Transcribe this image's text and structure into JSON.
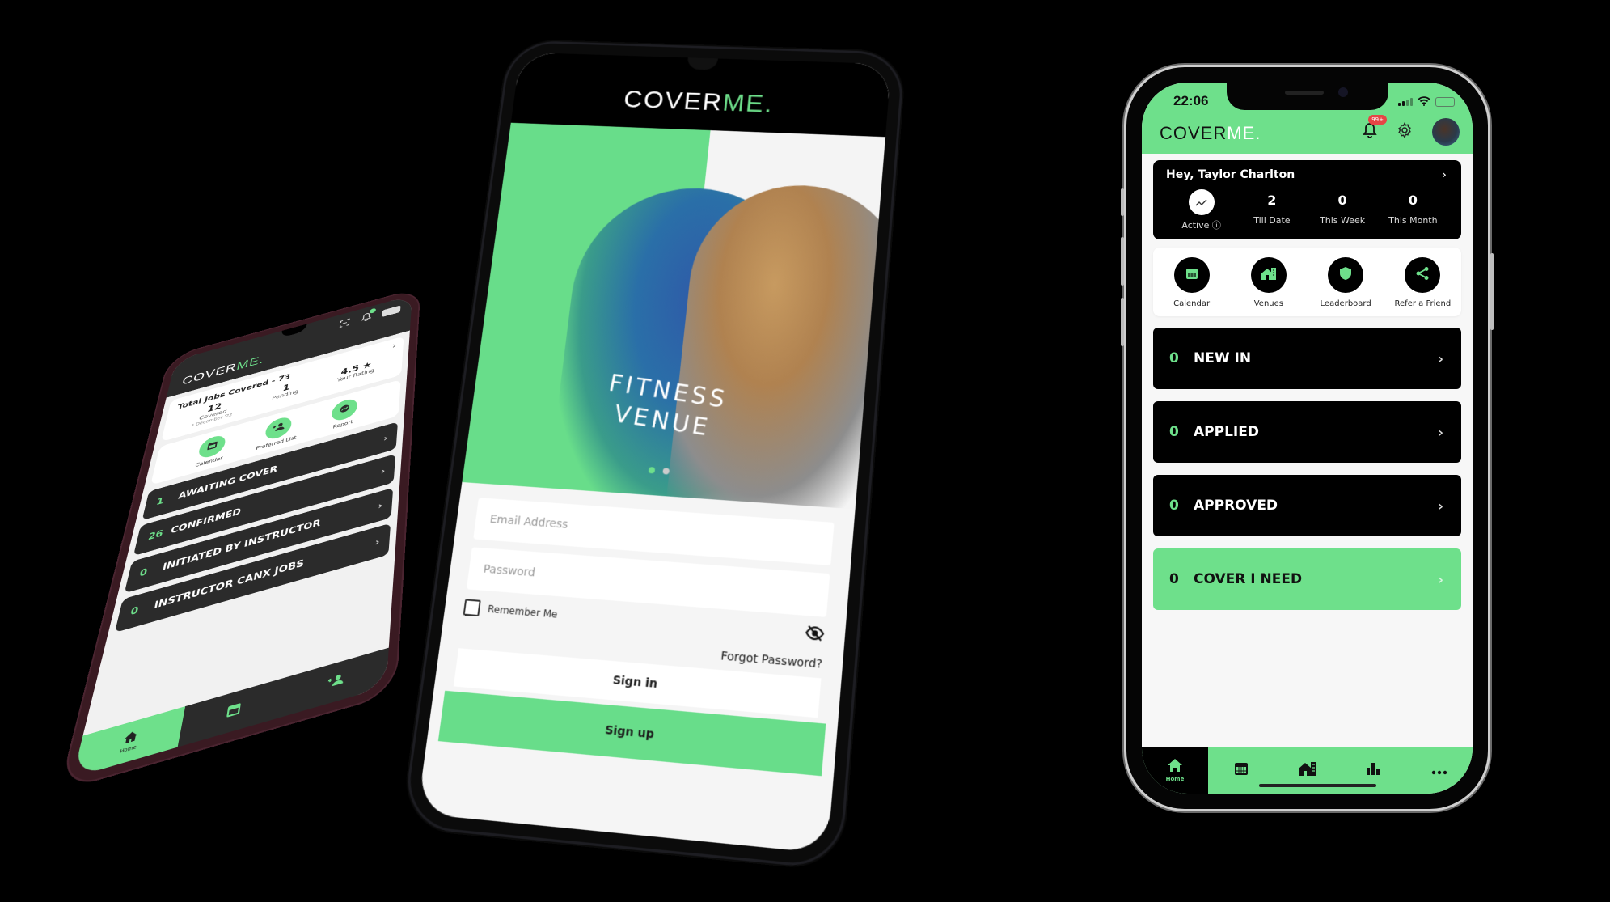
{
  "brand": {
    "name_part1": "COVER",
    "name_part2": "ME",
    "name_dot": ".",
    "accent_color": "#6ee08b",
    "dark_color": "#000000"
  },
  "left_phone": {
    "header": {
      "notification_badge": "",
      "icons": [
        "qr-scan-icon",
        "bell-icon",
        "battery-icon"
      ]
    },
    "summary": {
      "title": "Total Jobs Covered - 73",
      "stats": [
        {
          "value": "12",
          "label": "Covered",
          "sub": "* December '22"
        },
        {
          "value": "1",
          "label": "Pending",
          "sub": ""
        },
        {
          "value": "4.5 ★",
          "label": "Your Rating",
          "sub": ""
        }
      ]
    },
    "actions": [
      {
        "label": "Calendar",
        "icon": "calendar-icon"
      },
      {
        "label": "Preferred List",
        "icon": "add-user-icon"
      },
      {
        "label": "Report",
        "icon": "report-icon"
      }
    ],
    "rows": [
      {
        "count": "1",
        "label": "AWAITING COVER"
      },
      {
        "count": "26",
        "label": "CONFIRMED"
      },
      {
        "count": "0",
        "label": "INITIATED BY INSTRUCTOR"
      },
      {
        "count": "0",
        "label": "INSTRUCTOR CANX JOBS"
      }
    ],
    "tabs": [
      {
        "label": "Home",
        "icon": "home-icon",
        "active": true
      },
      {
        "label": "",
        "icon": "calendar-icon",
        "active": false
      },
      {
        "label": "",
        "icon": "add-user-icon",
        "active": false
      }
    ]
  },
  "middle_phone": {
    "hero": {
      "title_line1": "FITNESS",
      "title_line2": "VENUE",
      "carousel_pages": 2,
      "carousel_active": 1
    },
    "form": {
      "email_placeholder": "Email Address",
      "password_placeholder": "Password",
      "remember_label": "Remember Me",
      "remember_checked": false,
      "forgot_label": "Forgot Password?",
      "signin_label": "Sign in",
      "signup_label": "Sign up"
    }
  },
  "right_phone": {
    "status_bar": {
      "time": "22:06"
    },
    "header": {
      "notification_badge": "99+"
    },
    "greeting": "Hey, Taylor Charlton",
    "stats": [
      {
        "value": "",
        "label": "Active ⓘ",
        "icon": "trend-icon"
      },
      {
        "value": "2",
        "label": "Till Date"
      },
      {
        "value": "0",
        "label": "This Week"
      },
      {
        "value": "0",
        "label": "This Month"
      }
    ],
    "actions": [
      {
        "label": "Calendar",
        "icon": "calendar-icon"
      },
      {
        "label": "Venues",
        "icon": "venues-icon"
      },
      {
        "label": "Leaderboard",
        "icon": "shield-icon"
      },
      {
        "label": "Refer a Friend",
        "icon": "share-icon"
      }
    ],
    "rows": [
      {
        "count": "0",
        "label": "NEW IN"
      },
      {
        "count": "0",
        "label": "APPLIED"
      },
      {
        "count": "0",
        "label": "APPROVED"
      },
      {
        "count": "0",
        "label": "COVER I NEED"
      }
    ],
    "tabs": [
      {
        "label": "Home",
        "icon": "home-icon",
        "active": true
      },
      {
        "label": "",
        "icon": "calendar-icon"
      },
      {
        "label": "",
        "icon": "venues-icon"
      },
      {
        "label": "",
        "icon": "bar-chart-icon"
      },
      {
        "label": "",
        "icon": "more-icon"
      }
    ]
  }
}
